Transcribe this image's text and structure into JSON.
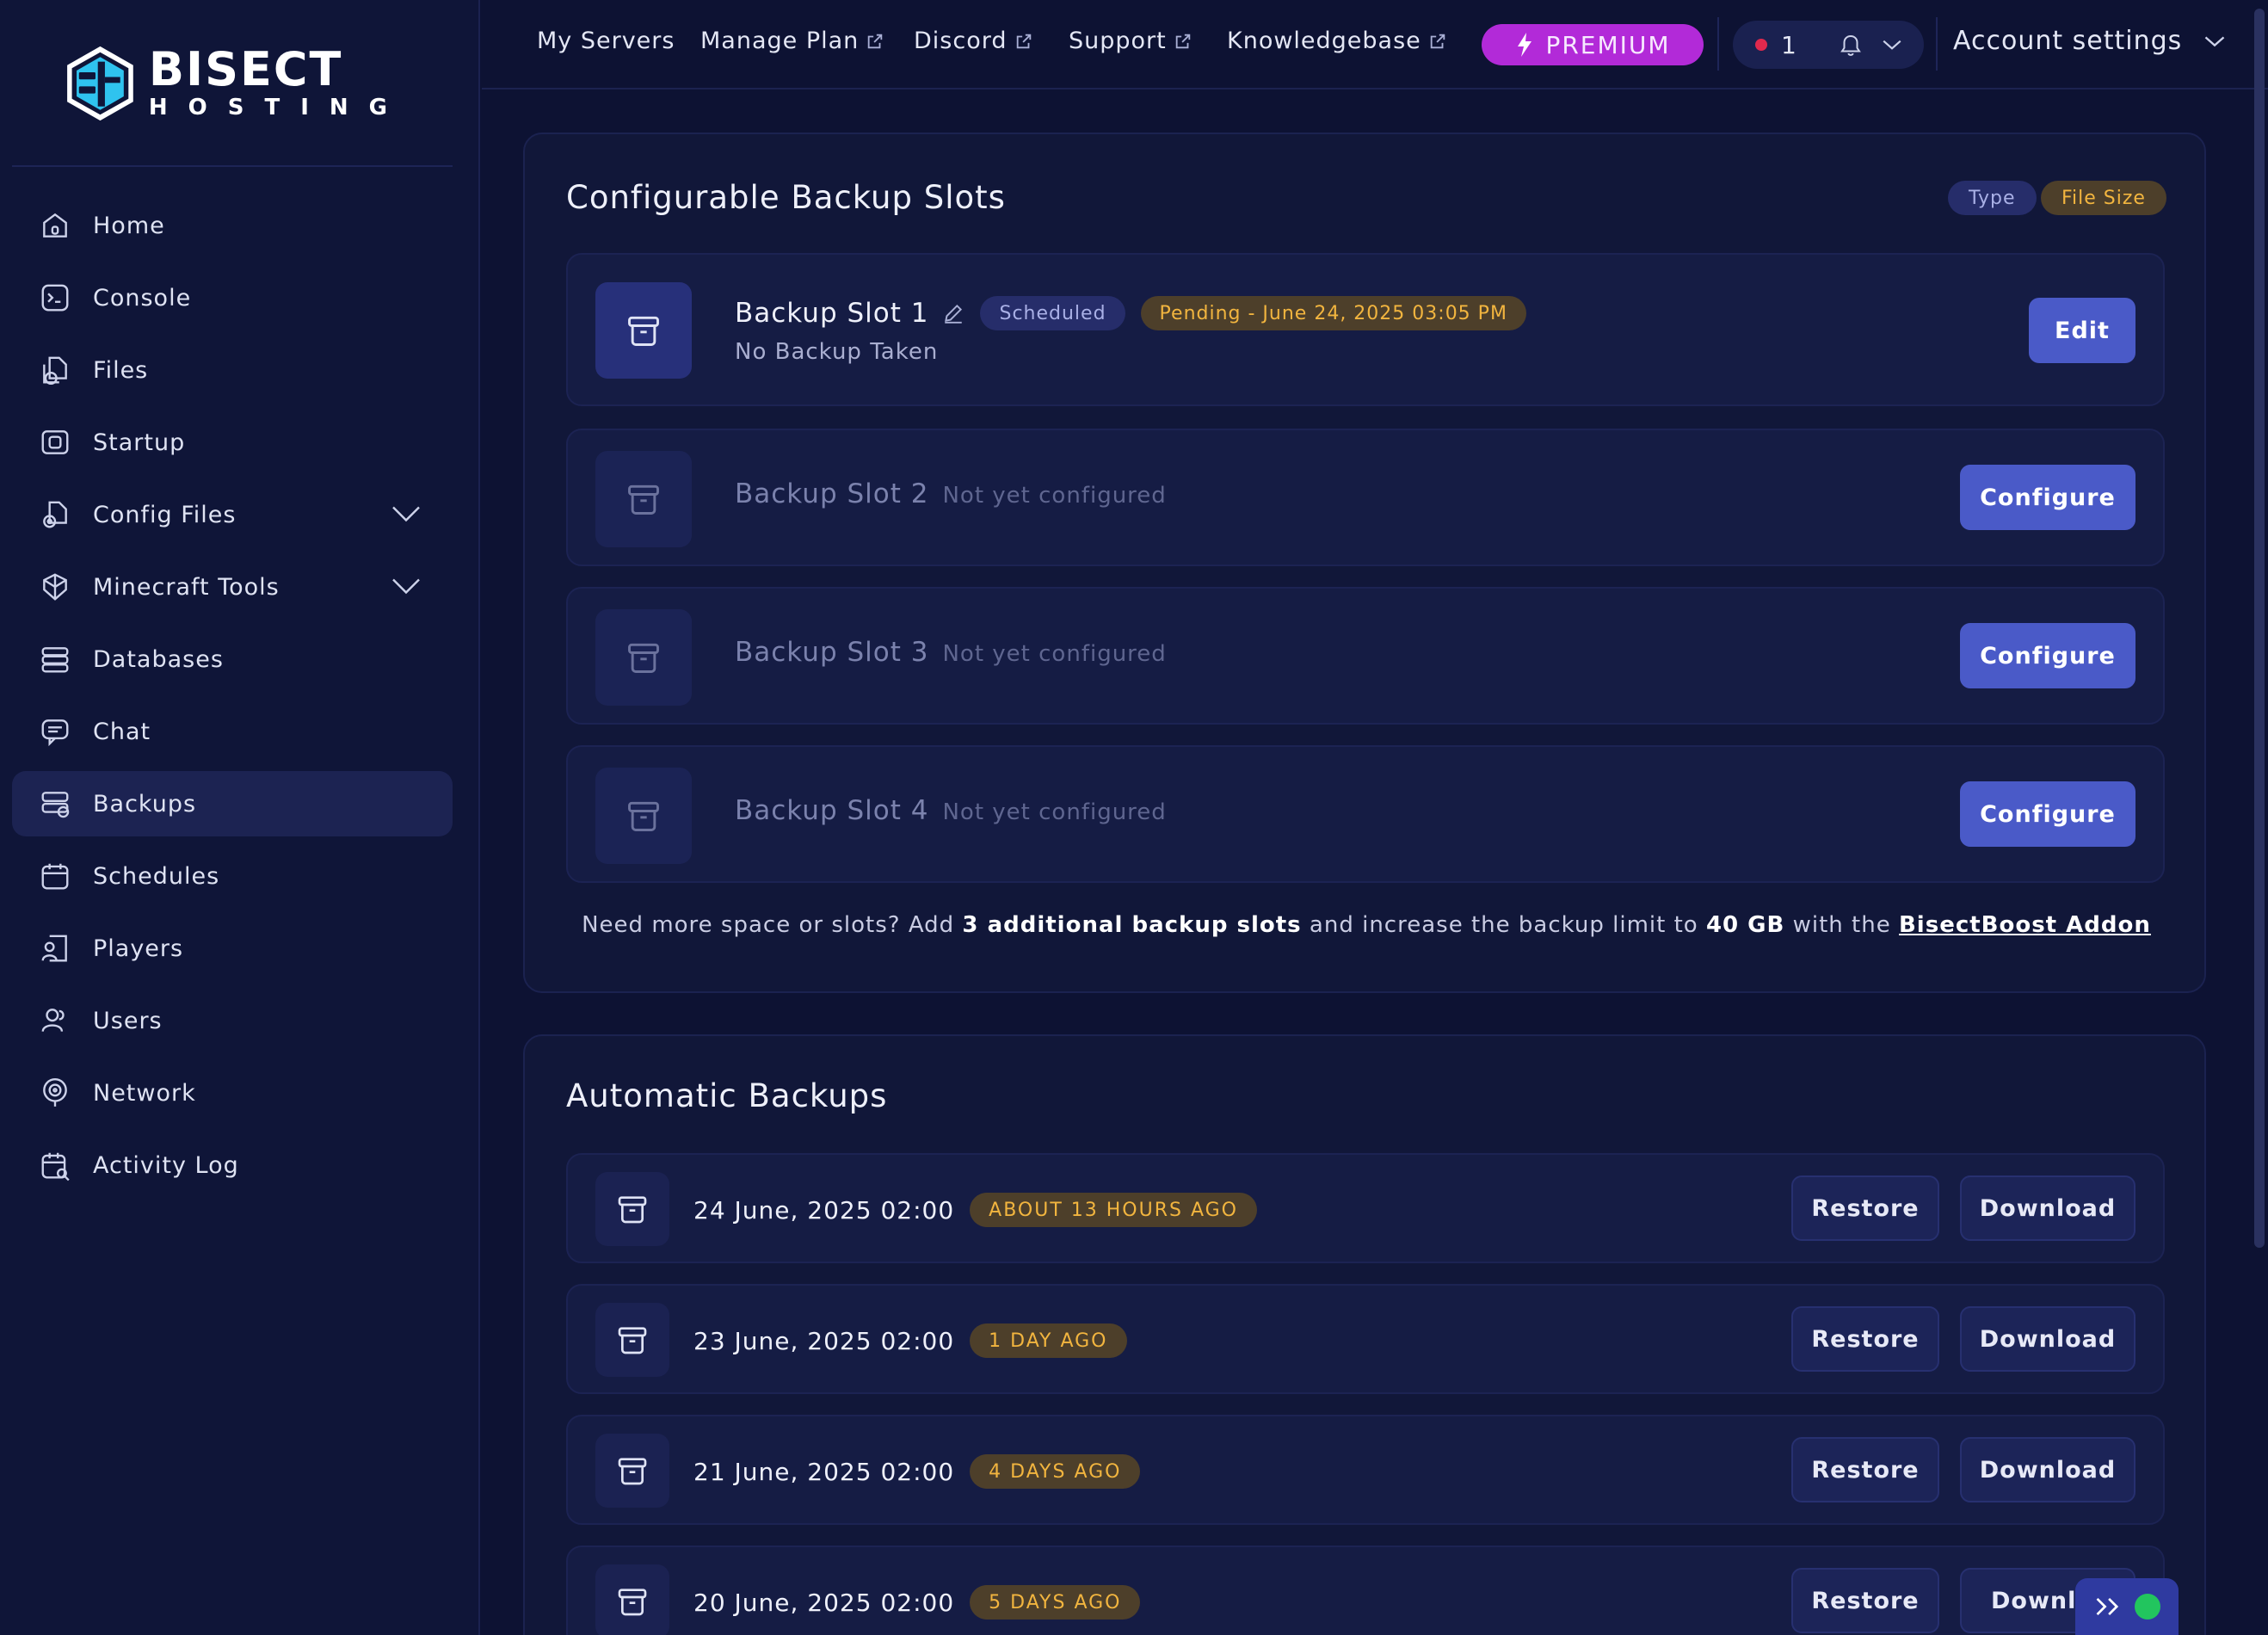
{
  "brand": {
    "word": "BISECT",
    "sub": "HOSTING"
  },
  "sidebar": {
    "items": [
      {
        "label": "Home",
        "icon": "home-icon"
      },
      {
        "label": "Console",
        "icon": "console-icon"
      },
      {
        "label": "Files",
        "icon": "files-icon"
      },
      {
        "label": "Startup",
        "icon": "startup-icon"
      },
      {
        "label": "Config Files",
        "icon": "config-files-icon",
        "expandable": true
      },
      {
        "label": "Minecraft Tools",
        "icon": "minecraft-tools-icon",
        "expandable": true
      },
      {
        "label": "Databases",
        "icon": "databases-icon"
      },
      {
        "label": "Chat",
        "icon": "chat-icon"
      },
      {
        "label": "Backups",
        "icon": "backups-icon",
        "active": true
      },
      {
        "label": "Schedules",
        "icon": "schedules-icon"
      },
      {
        "label": "Players",
        "icon": "players-icon"
      },
      {
        "label": "Users",
        "icon": "users-icon"
      },
      {
        "label": "Network",
        "icon": "network-icon"
      },
      {
        "label": "Activity Log",
        "icon": "activity-log-icon"
      }
    ]
  },
  "topbar": {
    "links": [
      "My Servers",
      "Manage Plan",
      "Discord",
      "Support",
      "Knowledgebase"
    ],
    "premium": "PREMIUM",
    "notification_count": "1",
    "account": "Account settings"
  },
  "colors": {
    "accent": "#4a5ac8",
    "premium": "#b22ad8",
    "badge_warn": "#f2b53f",
    "status_online": "#22c55e"
  },
  "configurable": {
    "title": "Configurable Backup Slots",
    "sort_type": "Type",
    "sort_size": "File Size",
    "slots": [
      {
        "name": "Backup Slot 1",
        "status": "Scheduled",
        "pending": "Pending - June 24, 2025 03:05 PM",
        "sub": "No Backup Taken",
        "button": "Edit"
      },
      {
        "name": "Backup Slot 2",
        "note": "Not yet configured",
        "button": "Configure"
      },
      {
        "name": "Backup Slot 3",
        "note": "Not yet configured",
        "button": "Configure"
      },
      {
        "name": "Backup Slot 4",
        "note": "Not yet configured",
        "button": "Configure"
      }
    ],
    "promo": {
      "p1": "Need more space or slots? Add ",
      "b1": "3 additional backup slots",
      "p2": " and increase the backup limit to ",
      "b2": "40 GB",
      "p3": " with the ",
      "link": "BisectBoost Addon"
    }
  },
  "automatic": {
    "title": "Automatic Backups",
    "restore_label": "Restore",
    "download_label": "Download",
    "download_label_cut": "Downlo",
    "rows": [
      {
        "date": "24 June, 2025 02:00",
        "ago": "ABOUT 13 HOURS AGO"
      },
      {
        "date": "23 June, 2025 02:00",
        "ago": "1 DAY AGO"
      },
      {
        "date": "21 June, 2025 02:00",
        "ago": "4 DAYS AGO"
      },
      {
        "date": "20 June, 2025 02:00",
        "ago": "5 DAYS AGO"
      }
    ]
  }
}
